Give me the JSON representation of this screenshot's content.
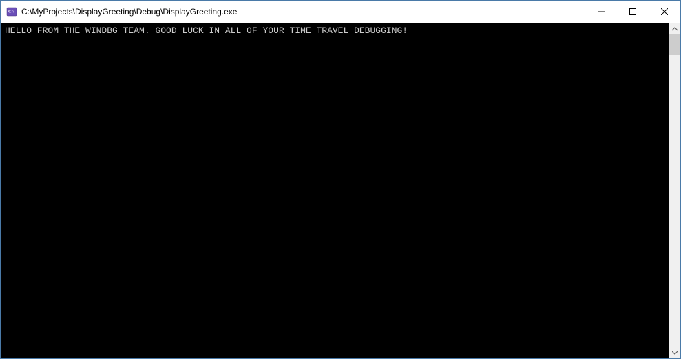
{
  "window": {
    "title": "C:\\MyProjects\\DisplayGreeting\\Debug\\DisplayGreeting.exe"
  },
  "console": {
    "output": "HELLO FROM THE WINDBG TEAM. GOOD LUCK IN ALL OF YOUR TIME TRAVEL DEBUGGING!"
  }
}
